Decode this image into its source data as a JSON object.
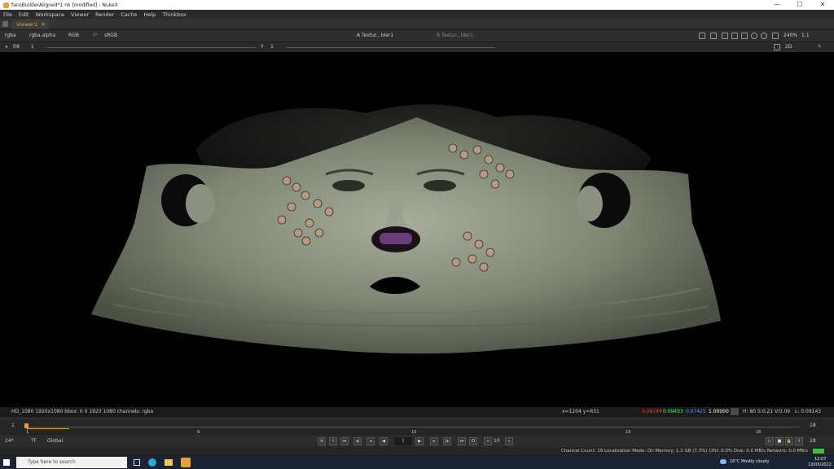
{
  "window": {
    "title": "faceBuilderAligned*1.nk [modified] - NukeX",
    "minimize": "—",
    "maximize": "☐",
    "close": "✕"
  },
  "menu": [
    "File",
    "Edit",
    "Workspace",
    "Viewer",
    "Render",
    "Cache",
    "Help",
    "Thinkbox"
  ],
  "tab": {
    "label": "Viewer1",
    "close": "✕"
  },
  "viewer_toolbar": {
    "channels": "rgba",
    "alpha": "rgba.alpha",
    "display": "RGB",
    "ip": "IP",
    "colorspace": "sRGB",
    "input_a": "A  Textur...lder1",
    "input_b": "B  Textur...lder1",
    "zoom": "240%",
    "proxy": "1:1"
  },
  "viewer_toolbar2": {
    "fstop": "f/8",
    "gain": "1",
    "gamma_label": "Y",
    "gamma": "1",
    "view_mode": "2D"
  },
  "info": {
    "format": "HD_1080 1920x1080  bbox: 0 0 1920 1080  channels: rgba",
    "coords": "x=1204 y=631",
    "r": "0.08749",
    "g": "0.09433",
    "b": "0.07425",
    "a": "1.00000",
    "hsv": "H: 80 S:0.21 V:0.09",
    "luma": "L: 0.09143",
    "colors": {
      "r": "#ff3b3b",
      "g": "#4cff4c",
      "b": "#4c6cff"
    }
  },
  "timeline": {
    "start": "1",
    "end": "18",
    "current": "1",
    "ticks": [
      "1",
      "9",
      "10",
      "19",
      "18"
    ]
  },
  "playback": {
    "fps": "24*",
    "tf": "TF",
    "range": "Global",
    "frame": "1",
    "increment": "10",
    "end_frame": "18"
  },
  "status": {
    "text": "Channel Count: 19  Localization Mode: On  Memory: 1.1 GB (7.3%)  CPU: 0.0%  Disk: 0.0 MB/s  Network: 0.0 MB/s"
  },
  "taskbar": {
    "search_placeholder": "Type here to search",
    "weather": "16°C  Mostly cloudy",
    "time": "12:07",
    "date": "13/05/2022"
  }
}
